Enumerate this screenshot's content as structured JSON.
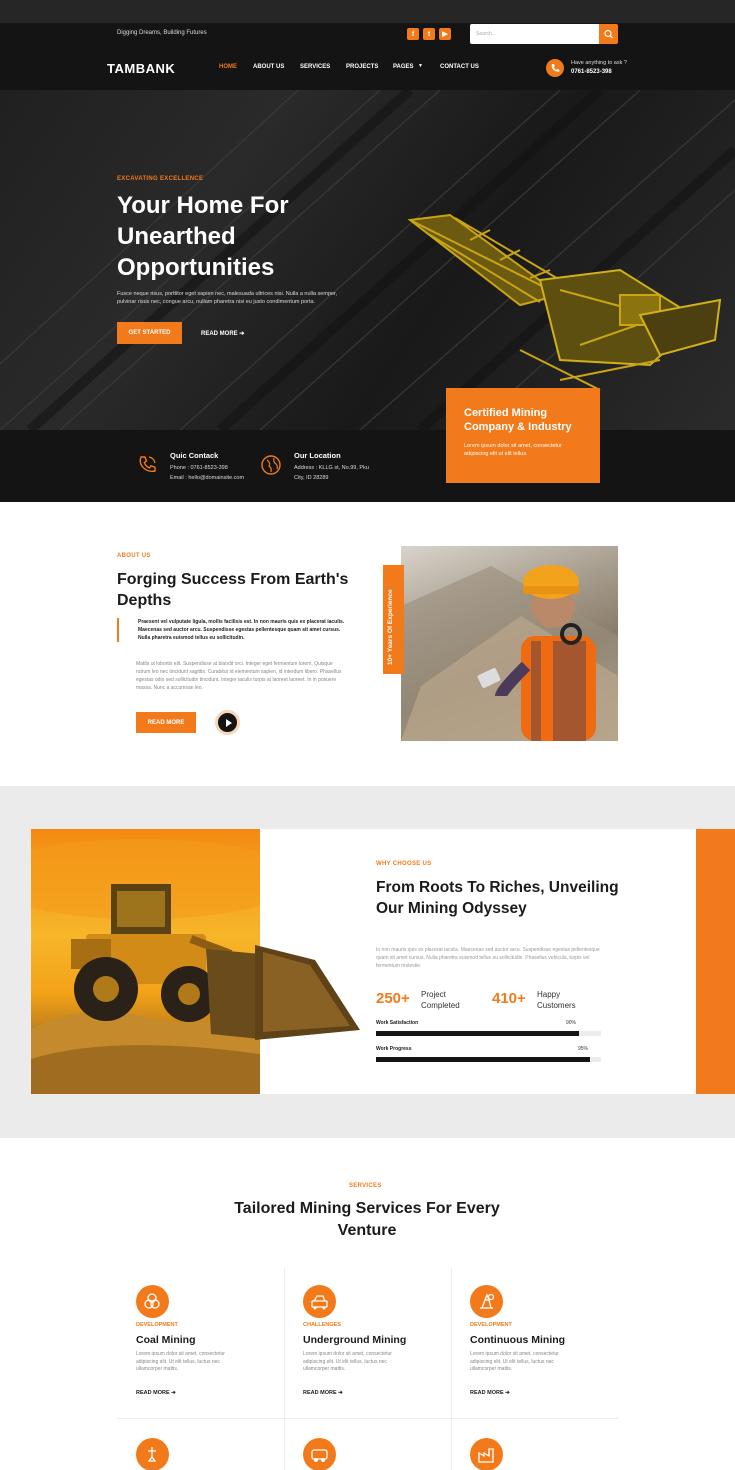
{
  "header": {
    "tagline": "Digging Dreams, Building Futures",
    "social": [
      "f",
      "t",
      "▶"
    ],
    "search_placeholder": "Search...",
    "logo": "TAMBANK",
    "nav": [
      "HOME",
      "ABOUT US",
      "SERVICES",
      "PROJECTS",
      "PAGES",
      "CONTACT US"
    ],
    "help_question": "Have anything to ask ?",
    "help_phone": "0761-8523-398"
  },
  "hero": {
    "eyebrow": "EXCAVATING EXCELLENCE",
    "title": "Your Home For Unearthed Opportunities",
    "text": "Fusce neque risus, porttitor eget sapien nec, malesuada ultrices nisi. Nulla a nulla semper, pulvinar risus nec, congue arcu, nullam pharetra nisi eu justo condimentum porta.",
    "cta_primary": "GET STARTED",
    "cta_secondary": "READ MORE",
    "certified_title": "Certified Mining Company & Industry",
    "certified_text": "Lorem ipsum dolor sit amet, consectetur adipiscing elit ut elit tellus."
  },
  "contact": {
    "quick_title": "Quic Contack",
    "quick_phone": "Phone : 0761-8523-398",
    "quick_email": "Email : hello@domainsite.com",
    "location_title": "Our Location",
    "location_line1": "Address : KLLG st, No.99, Pku",
    "location_line2": "City, ID 28289"
  },
  "about": {
    "eyebrow": "ABOUT US",
    "title": "Forging Success From Earth's Depths",
    "quote": "Praesent vel vulputate ligula, mollis facilisis est. In non mauris quis ex placerat iaculis. Maecenas sed auctor arcu. Suspendisse egestas pellentesque quam sit amet cursus. Nulla pharetra euismod tellus eu sollicitudin.",
    "text": "Mattis ut lobortis elit. Suspendisse at blandit orci. Integer eget fermentum lorem. Quisque rutrum leo nec tincidunt sagittis. Curabitur id elementum sapien, id interdum libero. Phasellus egestas odio sed sollicitudin tincidunt. Integer iaculis turpis at laoreet laoreet. In in posuere massa. Nunc a accumsan leo.",
    "button": "READ MORE",
    "years_badge": "10+ Years Of Experience"
  },
  "why": {
    "eyebrow": "WHY CHOOSE US",
    "title": "From Roots To Riches, Unveiling Our Mining Odyssey",
    "text": "In non mauris quis ex placerat iaculis. Maecenas sed auctor arcu. Suspendisse egestas pellentesque quam sit amet cursus. Nulla pharetra euismod tellus eu sollicitudin. Phasellus vehicula, turpis vel fermentum molestie.",
    "stats": [
      {
        "value": "250+",
        "label_line1": "Project",
        "label_line2": "Completed"
      },
      {
        "value": "410+",
        "label_line1": "Happy",
        "label_line2": "Customers"
      }
    ],
    "bars": [
      {
        "label": "Work Satisfaction",
        "percent_text": "90%",
        "value": 0.9
      },
      {
        "label": "Work Progress",
        "percent_text": "95%",
        "value": 0.95
      }
    ]
  },
  "services": {
    "eyebrow": "SERVICES",
    "title": "Tailored Mining Services For Every Venture",
    "items": [
      {
        "tag": "DEVELOPMENT",
        "name": "Coal Mining",
        "text": "Lorem ipsum dolor sit amet, consectetur adipiscing elit. Ut elit tellus, luctus nec ullamcorper mattis.",
        "link": "READ MORE"
      },
      {
        "tag": "CHALLENGES",
        "name": "Underground Mining",
        "text": "Lorem ipsum dolor sit amet, consectetur adipiscing elit. Ut elit tellus, luctus nec ullamcorper mattis.",
        "link": "READ MORE"
      },
      {
        "tag": "DEVELOPMENT",
        "name": "Continuous Mining",
        "text": "Lorem ipsum dolor sit amet, consectetur adipiscing elit. Ut elit tellus, luctus nec ullamcorper mattis.",
        "link": "READ MORE"
      }
    ]
  },
  "colors": {
    "accent": "#f27a1a",
    "dark": "#141414"
  }
}
